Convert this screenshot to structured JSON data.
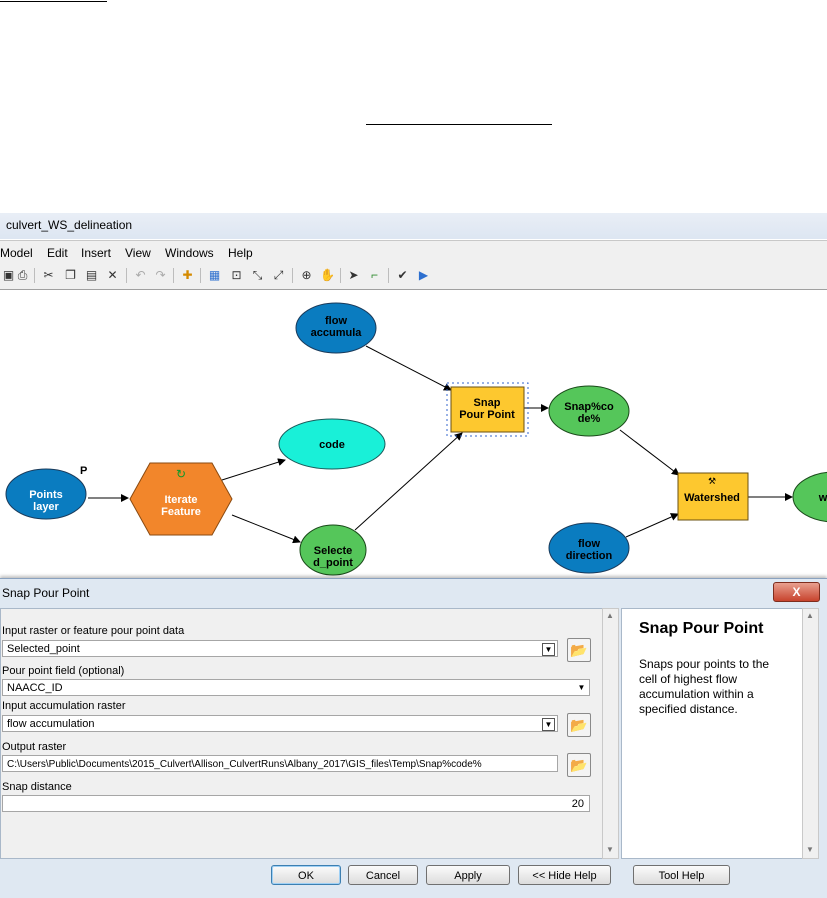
{
  "window": {
    "title": "culvert_WS_delineation"
  },
  "menu": [
    "Model",
    "Edit",
    "Insert",
    "View",
    "Windows",
    "Help"
  ],
  "model": {
    "nodes": {
      "flow_acc": "flow accumula",
      "points_layer": "Points layer",
      "param_marker": "P",
      "iterate": "Iterate Feature",
      "code": "code",
      "selected_point": "Selecte d_point",
      "snap_tool": "Snap Pour Point",
      "snap_out": "Snap%co de%",
      "flow_dir": "flow direction",
      "watershed": "Watershed",
      "ws_out": "w"
    },
    "colors": {
      "blue": "#0a7cc0",
      "orange": "#f2862b",
      "cyan": "#19f0d8",
      "green": "#55c65a",
      "yellow": "#fdc82f"
    }
  },
  "dialog": {
    "title": "Snap Pour Point",
    "close": "X",
    "fields": {
      "input_label": "Input raster or feature pour point data",
      "input_value": "Selected_point",
      "pourfield_label": "Pour point field (optional)",
      "pourfield_value": "NAACC_ID",
      "accum_label": "Input accumulation raster",
      "accum_value": "flow accumulation",
      "output_label": "Output raster",
      "output_value": "C:\\Users\\Public\\Documents\\2015_Culvert\\Allison_CulvertRuns\\Albany_2017\\GIS_files\\Temp\\Snap%code%",
      "snap_label": "Snap distance",
      "snap_value": "20"
    },
    "help": {
      "title": "Snap Pour Point",
      "body": "Snaps pour points to the cell of highest flow accumulation within a specified distance."
    },
    "buttons": {
      "ok": "OK",
      "cancel": "Cancel",
      "apply": "Apply",
      "hide_help": "<< Hide Help",
      "tool_help": "Tool Help"
    }
  }
}
